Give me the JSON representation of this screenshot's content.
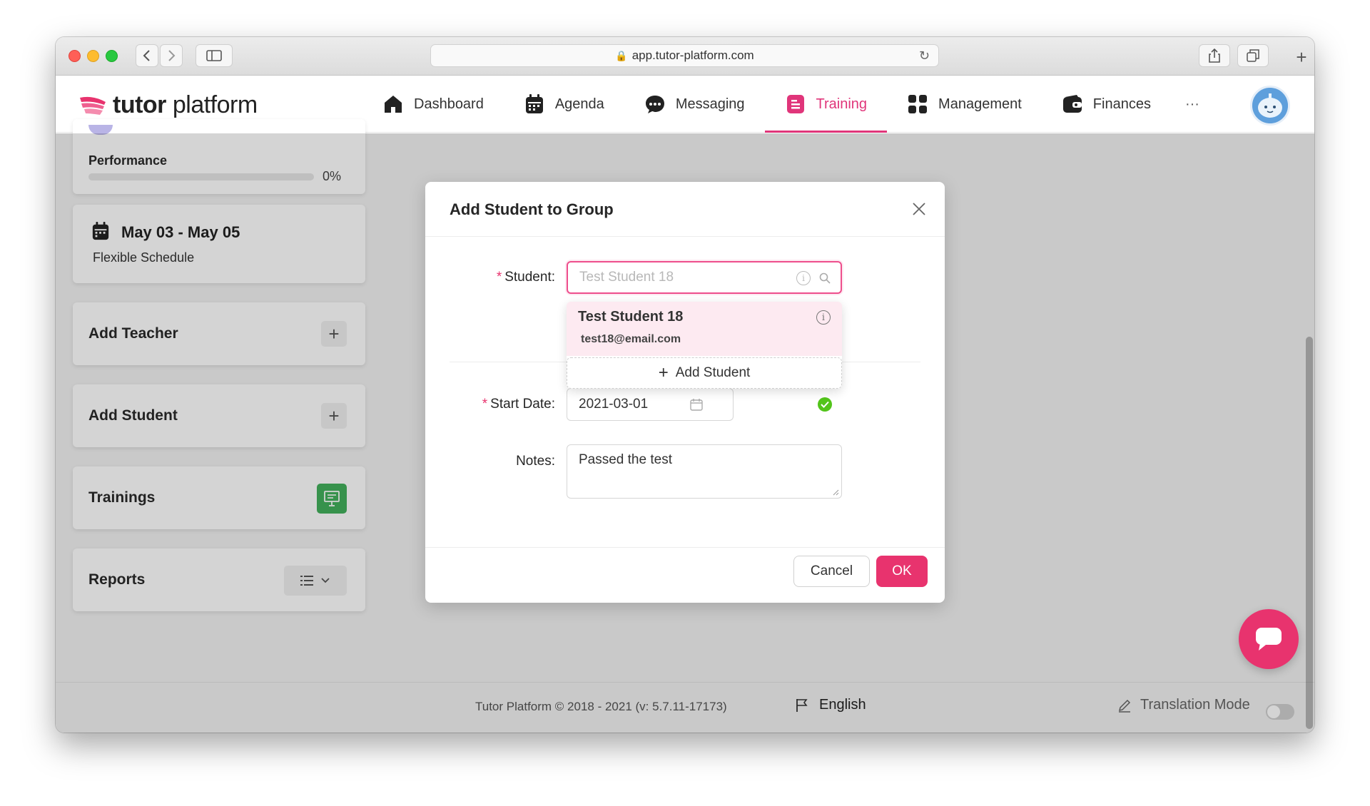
{
  "browser": {
    "url": "app.tutor-platform.com"
  },
  "header": {
    "brand_bold": "tutor",
    "brand_light": " platform",
    "nav": [
      {
        "label": "Dashboard",
        "icon": "home-icon"
      },
      {
        "label": "Agenda",
        "icon": "calendar-icon"
      },
      {
        "label": "Messaging",
        "icon": "chat-icon"
      },
      {
        "label": "Training",
        "icon": "training-icon",
        "active": true
      },
      {
        "label": "Management",
        "icon": "grid-icon"
      },
      {
        "label": "Finances",
        "icon": "wallet-icon"
      }
    ],
    "more": "···"
  },
  "sidebar": {
    "performance_label": "Performance",
    "performance_value": "0%",
    "performance_progress": 0,
    "schedule_dates": "May 03 - May 05",
    "schedule_type": "Flexible Schedule",
    "add_teacher": "Add Teacher",
    "add_student": "Add Student",
    "trainings": "Trainings",
    "reports": "Reports"
  },
  "modal": {
    "title": "Add Student to Group",
    "student_label": "Student",
    "student_placeholder": "Test Student 18",
    "dropdown_option_name": "Test Student 18",
    "dropdown_option_email": "test18@email.com",
    "dropdown_add": "Add Student",
    "start_date_label": "Start Date",
    "start_date_value": "2021-03-01",
    "notes_label": "Notes",
    "notes_value": "Passed the test",
    "cancel": "Cancel",
    "ok": "OK"
  },
  "footer": {
    "copyright": "Tutor Platform © 2018 - 2021 (v: 5.7.11-17173)",
    "language": "English",
    "translation_mode": "Translation Mode"
  },
  "colors": {
    "accent": "#e8336e",
    "success": "#52c41a"
  }
}
